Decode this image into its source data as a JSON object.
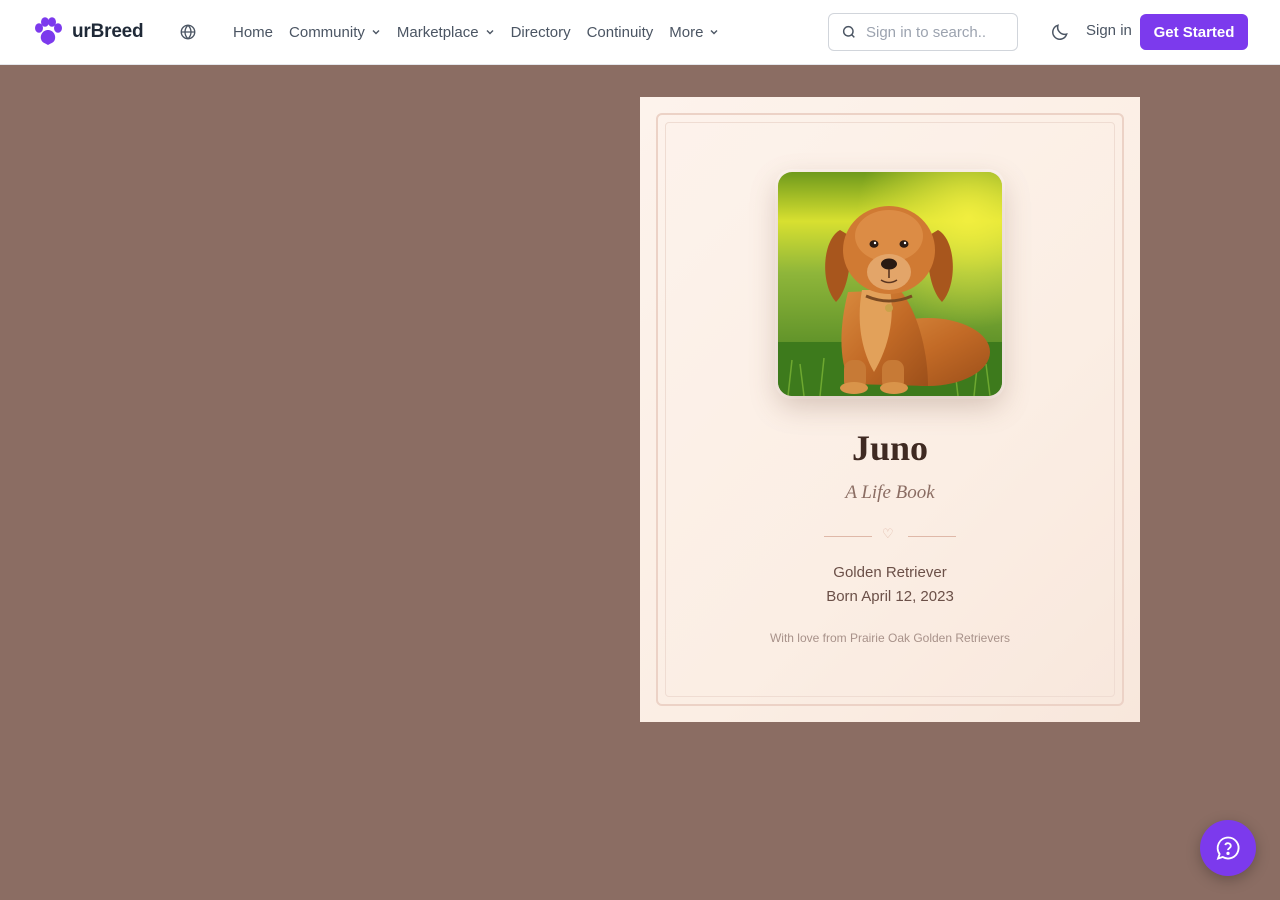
{
  "header": {
    "brand": "urBreed",
    "nav": {
      "home": "Home",
      "community": "Community",
      "marketplace": "Marketplace",
      "directory": "Directory",
      "continuity": "Continuity",
      "more": "More"
    },
    "search": {
      "placeholder": "Sign in to search.."
    },
    "signin_label": "Sign in",
    "cta_label": "Get Started",
    "icons": [
      "paw-logo-icon",
      "globe-icon",
      "chevron-down-icon",
      "search-icon",
      "moon-icon"
    ]
  },
  "card": {
    "name": "Juno",
    "subtitle": "A Life Book",
    "divider_glyph": "♡",
    "breed": "Golden Retriever",
    "born": "Born April 12, 2023",
    "dedication": "With love from Prairie Oak Golden Retrievers",
    "photo_subject": "golden-retriever-photo"
  },
  "help": {
    "icon": "help-chat-icon"
  },
  "colors": {
    "page_background": "#8b6d63",
    "accent": "#7c3aed",
    "card_background": "#fdf3ec",
    "title_text": "#3f2a22"
  }
}
